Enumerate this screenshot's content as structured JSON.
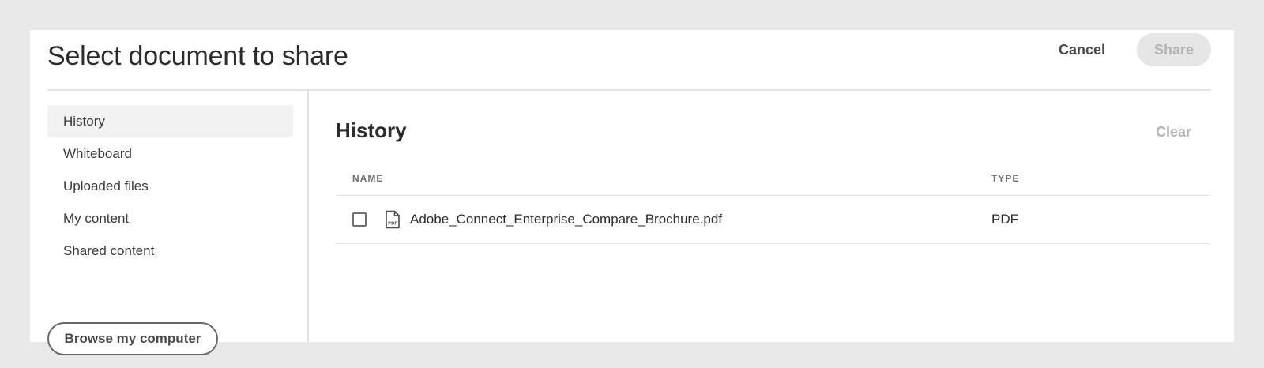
{
  "dialog": {
    "title": "Select document to share",
    "cancel_label": "Cancel",
    "share_label": "Share"
  },
  "sidebar": {
    "items": [
      {
        "label": "History",
        "active": true
      },
      {
        "label": "Whiteboard",
        "active": false
      },
      {
        "label": "Uploaded files",
        "active": false
      },
      {
        "label": "My content",
        "active": false
      },
      {
        "label": "Shared content",
        "active": false
      }
    ],
    "browse_label": "Browse my computer"
  },
  "main": {
    "title": "History",
    "clear_label": "Clear",
    "columns": {
      "name": "NAME",
      "type": "TYPE"
    },
    "rows": [
      {
        "name": "Adobe_Connect_Enterprise_Compare_Brochure.pdf",
        "type": "PDF",
        "icon": "pdf-file-icon",
        "checked": false
      }
    ]
  },
  "colors": {
    "background": "#e9e9e9",
    "surface": "#ffffff",
    "active_item": "#f2f2f2",
    "disabled_button": "#e6e6e6",
    "disabled_text": "#b3b3b3"
  }
}
